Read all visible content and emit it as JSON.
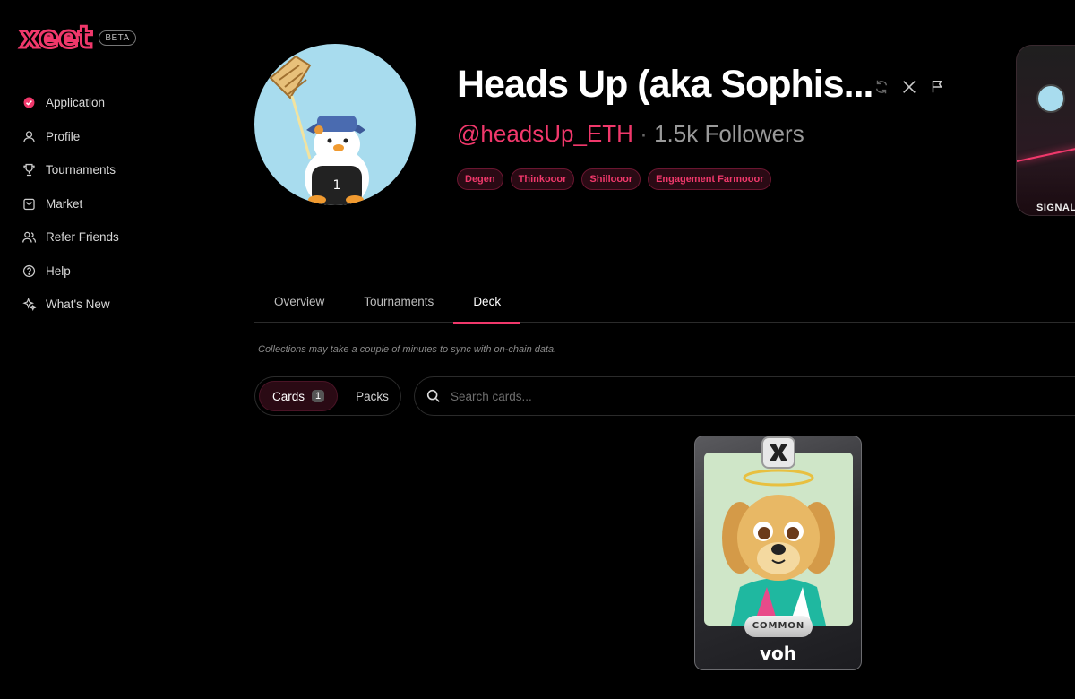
{
  "app": {
    "logo": "xeet",
    "badge": "BETA"
  },
  "sidebar": {
    "items": [
      {
        "label": "Application",
        "icon": "verified-badge-icon"
      },
      {
        "label": "Profile",
        "icon": "user-icon"
      },
      {
        "label": "Tournaments",
        "icon": "trophy-icon"
      },
      {
        "label": "Market",
        "icon": "shopping-bag-icon"
      },
      {
        "label": "Refer Friends",
        "icon": "users-icon"
      },
      {
        "label": "Help",
        "icon": "help-circle-icon"
      },
      {
        "label": "What's New",
        "icon": "sparkles-icon"
      }
    ]
  },
  "profile": {
    "name": "Heads Up (aka Sophis...",
    "handle": "@headsUp_ETH",
    "separator": "·",
    "followers_count": "1.5k",
    "followers_label": "Followers",
    "tags": [
      "Degen",
      "Thinkooor",
      "Shillooor",
      "Engagement Farmooor"
    ]
  },
  "side_card": {
    "label": "SIGNAL"
  },
  "tabs": [
    "Overview",
    "Tournaments",
    "Deck"
  ],
  "active_tab": "Deck",
  "notice": "Collections may take a couple of minutes to sync with on-chain data.",
  "deck": {
    "toggle": {
      "cards_label": "Cards",
      "cards_count": "1",
      "packs_label": "Packs"
    },
    "search": {
      "placeholder": "Search cards..."
    },
    "cards": [
      {
        "name": "voh",
        "rarity": "COMMON"
      }
    ]
  },
  "colors": {
    "accent": "#f0386b",
    "background": "#000000"
  }
}
